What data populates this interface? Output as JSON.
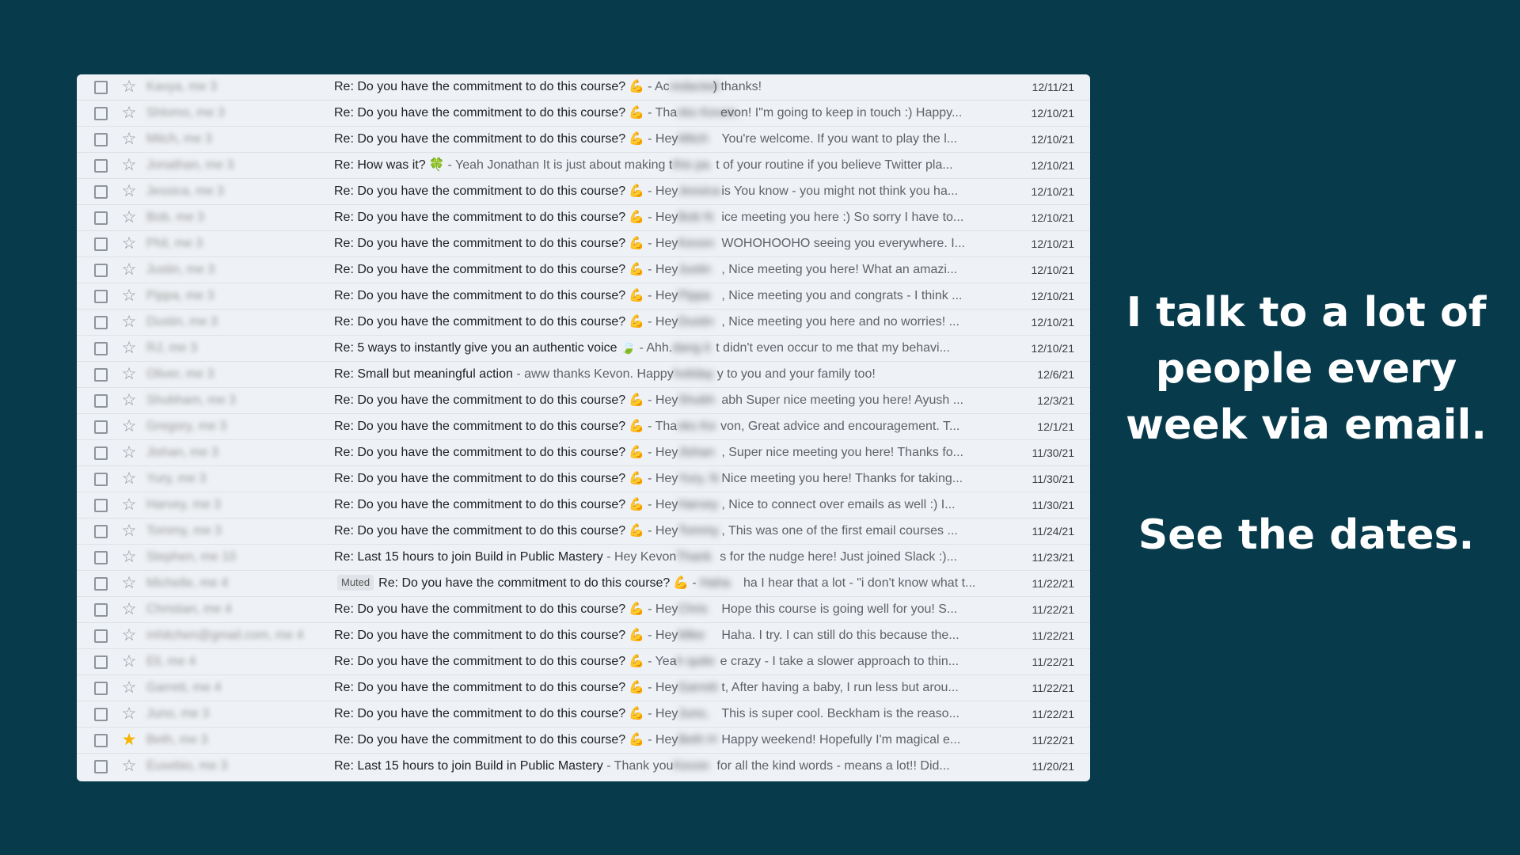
{
  "caption": {
    "line1": "I talk to a lot of people every week via email.",
    "line2": "See the dates."
  },
  "badges": {
    "muted": "Muted"
  },
  "icons": {
    "checkbox": "checkbox-icon",
    "star": "star-icon",
    "flex": "💪",
    "clover": "🍀",
    "leaf": "🍃"
  },
  "colors": {
    "background": "#073a4b",
    "star_active": "#f4b400"
  },
  "emails": [
    {
      "sender": "Kavya, me 3",
      "subject": "Re: Do you have the commitment to do this course?",
      "emoji": "💪",
      "pre_a": "Ac",
      "redact": "redacted",
      "preview": ") thanks!",
      "date": "12/11/21",
      "starred": false,
      "muted": false
    },
    {
      "sender": "Shlomo, me 3",
      "subject": "Re: Do you have the commitment to do this course?",
      "emoji": "💪",
      "pre_a": "Tha",
      "redact": "nks Kevon",
      "preview": "evon! I\"m going to keep in touch :) Happy...",
      "date": "12/10/21",
      "starred": false,
      "muted": false
    },
    {
      "sender": "Mitch, me 3",
      "subject": "Re: Do you have the commitment to do this course?",
      "emoji": "💪",
      "pre_a": "Hey",
      "redact": "Mitch",
      "preview": "You're welcome. If you want to play the l...",
      "date": "12/10/21",
      "starred": false,
      "muted": false
    },
    {
      "sender": "Jonathan, me 3",
      "subject": "Re: How was it?",
      "emoji": "🍀",
      "pre_a": "Yeah Jonathan It is just about making t",
      "redact": "this pa",
      "preview": "t of your routine if you believe Twitter pla...",
      "date": "12/10/21",
      "starred": false,
      "muted": false
    },
    {
      "sender": "Jessica, me 3",
      "subject": "Re: Do you have the commitment to do this course?",
      "emoji": "💪",
      "pre_a": "Hey",
      "redact": "Jessica",
      "preview": "is You know - you might not think you ha...",
      "date": "12/10/21",
      "starred": false,
      "muted": false
    },
    {
      "sender": "Bob, me 3",
      "subject": "Re: Do you have the commitment to do this course?",
      "emoji": "💪",
      "pre_a": "Hey",
      "redact": "Bob N",
      "preview": "ice meeting you here :) So sorry I have to...",
      "date": "12/10/21",
      "starred": false,
      "muted": false
    },
    {
      "sender": "Phil, me 3",
      "subject": "Re: Do you have the commitment to do this course?",
      "emoji": "💪",
      "pre_a": "Hey",
      "redact": "Kevon",
      "preview": "WOHOHOOHO seeing you everywhere. I...",
      "date": "12/10/21",
      "starred": false,
      "muted": false
    },
    {
      "sender": "Justin, me 3",
      "subject": "Re: Do you have the commitment to do this course?",
      "emoji": "💪",
      "pre_a": "Hey",
      "redact": "Justin",
      "preview": ", Nice meeting you here! What an amazi...",
      "date": "12/10/21",
      "starred": false,
      "muted": false
    },
    {
      "sender": "Pippa, me 3",
      "subject": "Re: Do you have the commitment to do this course?",
      "emoji": "💪",
      "pre_a": "Hey",
      "redact": "Pippa",
      "preview": ", Nice meeting you and congrats - I think ...",
      "date": "12/10/21",
      "starred": false,
      "muted": false
    },
    {
      "sender": "Dustin, me 3",
      "subject": "Re: Do you have the commitment to do this course?",
      "emoji": "💪",
      "pre_a": "Hey",
      "redact": "Dustin",
      "preview": ", Nice meeting you here and no worries! ...",
      "date": "12/10/21",
      "starred": false,
      "muted": false
    },
    {
      "sender": "RJ, me 3",
      "subject": "Re: 5 ways to instantly give you an authentic voice",
      "emoji": "🍃",
      "pre_a": "Ahh.",
      "redact": "dang it",
      "preview": "t didn't even occur to me that my behavi...",
      "date": "12/10/21",
      "starred": false,
      "muted": false
    },
    {
      "sender": "Oliver, me 3",
      "subject": "Re: Small but meaningful action",
      "emoji": "",
      "pre_a": "aww thanks Kevon. Happy",
      "redact": "holiday",
      "preview": "y to you and your family too!",
      "date": "12/6/21",
      "starred": false,
      "muted": false
    },
    {
      "sender": "Shubham, me 3",
      "subject": "Re: Do you have the commitment to do this course?",
      "emoji": "💪",
      "pre_a": "Hey",
      "redact": "Shubh",
      "preview": "abh Super nice meeting you here! Ayush ...",
      "date": "12/3/21",
      "starred": false,
      "muted": false
    },
    {
      "sender": "Gregory, me 3",
      "subject": "Re: Do you have the commitment to do this course?",
      "emoji": "💪",
      "pre_a": "Tha",
      "redact": "nks Ke",
      "preview": "von, Great advice and encouragement. T...",
      "date": "12/1/21",
      "starred": false,
      "muted": false
    },
    {
      "sender": "Jishan, me 3",
      "subject": "Re: Do you have the commitment to do this course?",
      "emoji": "💪",
      "pre_a": "Hey",
      "redact": "Jishan",
      "preview": ", Super nice meeting you here! Thanks fo...",
      "date": "11/30/21",
      "starred": false,
      "muted": false
    },
    {
      "sender": "Yury, me 3",
      "subject": "Re: Do you have the commitment to do this course?",
      "emoji": "💪",
      "pre_a": "Hey",
      "redact": "Yury, N",
      "preview": "Nice meeting you here! Thanks for taking...",
      "date": "11/30/21",
      "starred": false,
      "muted": false
    },
    {
      "sender": "Harvey, me 3",
      "subject": "Re: Do you have the commitment to do this course?",
      "emoji": "💪",
      "pre_a": "Hey",
      "redact": "Harvey",
      "preview": ", Nice to connect over emails as well :) I...",
      "date": "11/30/21",
      "starred": false,
      "muted": false
    },
    {
      "sender": "Tommy, me 3",
      "subject": "Re: Do you have the commitment to do this course?",
      "emoji": "💪",
      "pre_a": "Hey",
      "redact": "Tommy",
      "preview": ", This was one of the first email courses ...",
      "date": "11/24/21",
      "starred": false,
      "muted": false
    },
    {
      "sender": "Stephen, me 10",
      "subject": "Re: Last 15 hours to join Build in Public Mastery",
      "emoji": "",
      "pre_a": "Hey Kevon",
      "redact": "Thank",
      "preview": "s for the nudge here! Just joined Slack :)...",
      "date": "11/23/21",
      "starred": false,
      "muted": false
    },
    {
      "sender": "Michelle, me 4",
      "subject": "Re: Do you have the commitment to do this course?",
      "emoji": "💪",
      "pre_a": "",
      "redact": "Haha",
      "preview": "ha I hear that a lot - \"i don't know what t...",
      "date": "11/22/21",
      "starred": false,
      "muted": true
    },
    {
      "sender": "Christian, me 4",
      "subject": "Re: Do you have the commitment to do this course?",
      "emoji": "💪",
      "pre_a": "Hey",
      "redact": "Chris",
      "preview": "Hope this course is going well for you! S...",
      "date": "11/22/21",
      "starred": false,
      "muted": false
    },
    {
      "sender": "mhitchen@gmail.com, me 4",
      "subject": "Re: Do you have the commitment to do this course?",
      "emoji": "💪",
      "pre_a": "Hey",
      "redact": "Mike",
      "preview": "Haha. I try. I can still do this because the...",
      "date": "11/22/21",
      "starred": false,
      "muted": false
    },
    {
      "sender": "Eli, me 4",
      "subject": "Re: Do you have the commitment to do this course?",
      "emoji": "💪",
      "pre_a": "Yea",
      "redact": "h quite",
      "preview": "e crazy - I take a slower approach to thin...",
      "date": "11/22/21",
      "starred": false,
      "muted": false
    },
    {
      "sender": "Garrett, me 4",
      "subject": "Re: Do you have the commitment to do this course?",
      "emoji": "💪",
      "pre_a": "Hey",
      "redact": "Garrett",
      "preview": "t, After having a baby, I run less but arou...",
      "date": "11/22/21",
      "starred": false,
      "muted": false
    },
    {
      "sender": "Juno, me 3",
      "subject": "Re: Do you have the commitment to do this course?",
      "emoji": "💪",
      "pre_a": "Hey",
      "redact": "Juno,",
      "preview": "This is super cool. Beckham is the reaso...",
      "date": "11/22/21",
      "starred": false,
      "muted": false
    },
    {
      "sender": "Beth, me 3",
      "subject": "Re: Do you have the commitment to do this course?",
      "emoji": "💪",
      "pre_a": "Hey",
      "redact": "Beth H",
      "preview": "Happy weekend! Hopefully I'm magical e...",
      "date": "11/22/21",
      "starred": true,
      "muted": false
    },
    {
      "sender": "Eusebio, me 3",
      "subject": "Re: Last 15 hours to join Build in Public Mastery",
      "emoji": "",
      "pre_a": "Thank you",
      "redact": "Kevon",
      "preview": "for all the kind words - means a lot!! Did...",
      "date": "11/20/21",
      "starred": false,
      "muted": false
    }
  ]
}
